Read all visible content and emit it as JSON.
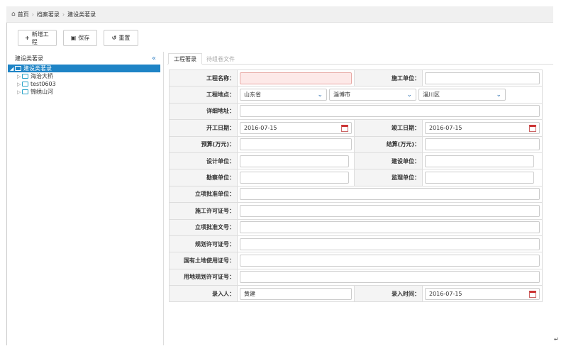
{
  "breadcrumb": {
    "items": [
      "首页",
      "档案著录",
      "建设类著录"
    ]
  },
  "toolbar": {
    "add_label": "新增工程",
    "save_label": "保存",
    "reset_label": "重置"
  },
  "sidebar": {
    "title": "建设类著录",
    "collapse_glyph": "«",
    "root_label": "建设类著录",
    "children": [
      "海治大桥",
      "test0603",
      "锦绣山河"
    ]
  },
  "tabs": [
    "工程著录",
    "待组卷文件"
  ],
  "form": {
    "project_name_label": "工程名称：",
    "project_name_value": "",
    "contractor_label": "施工单位：",
    "contractor_value": "",
    "location_label": "工程地点：",
    "province": "山东省",
    "city": "淄博市",
    "district": "淄川区",
    "address_label": "详细地址：",
    "start_date_label": "开工日期：",
    "start_date_value": "2016-07-15",
    "end_date_label": "竣工日期：",
    "end_date_value": "2016-07-15",
    "budget_label": "预算(万元)：",
    "settlement_label": "结算(万元)：",
    "design_unit_label": "设计单位：",
    "build_unit_label": "建设单位：",
    "survey_unit_label": "勘察单位：",
    "supervise_unit_label": "监理单位：",
    "approval_unit_label": "立项批准单位：",
    "permit_no_label": "施工许可证号：",
    "approval_doc_label": "立项批准文号：",
    "planning_permit_label": "规划许可证号：",
    "land_cert_label": "国有土地使用证号：",
    "land_planning_label": "用地规划许可证号：",
    "entered_by_label": "录入人：",
    "entered_by_value": "黄建",
    "entry_time_label": "录入时间：",
    "entry_time_value": "2016-07-15"
  },
  "corner_mark": "↵"
}
